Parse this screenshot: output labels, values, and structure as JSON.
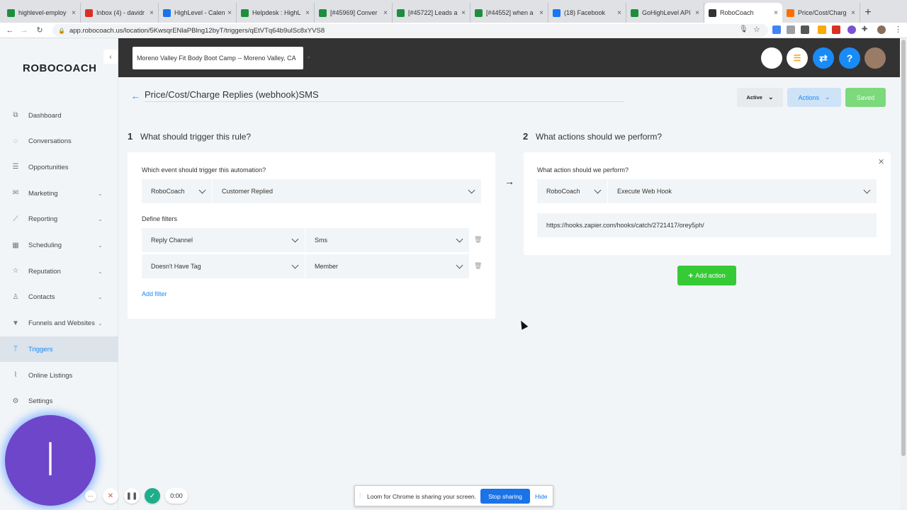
{
  "browser": {
    "tabs": [
      {
        "label": "highlevel-employ",
        "color": "#1e8e3e"
      },
      {
        "label": "Inbox (4) - davidr",
        "color": "#d93025"
      },
      {
        "label": "HighLevel - Calen",
        "color": "#1a73e8"
      },
      {
        "label": "Helpdesk : HighL",
        "color": "#1e8e3e"
      },
      {
        "label": "[#45969] Conver",
        "color": "#1e8e3e"
      },
      {
        "label": "[#45722] Leads a",
        "color": "#1e8e3e"
      },
      {
        "label": "[#44552] when a",
        "color": "#1e8e3e"
      },
      {
        "label": "(18) Facebook",
        "color": "#1877f2"
      },
      {
        "label": "GoHighLevel API",
        "color": "#1e8e3e"
      },
      {
        "label": "RoboCoach",
        "color": "#333333",
        "active": true
      },
      {
        "label": "Price/Cost/Charg",
        "color": "#ff6d00"
      }
    ],
    "url": "app.robocoach.us/location/5KwsqrENlaPBlng12byT/triggers/qEtVTq64b9ulSc8xYVS8"
  },
  "sidebar": {
    "logo": "ROBOCOACH",
    "items": [
      {
        "label": "Dashboard",
        "icon": "dashboard-icon",
        "glyph": "⧉"
      },
      {
        "label": "Conversations",
        "icon": "chat-icon",
        "glyph": "◌"
      },
      {
        "label": "Opportunities",
        "icon": "layers-icon",
        "glyph": "☰"
      },
      {
        "label": "Marketing",
        "icon": "mail-icon",
        "glyph": "✉",
        "chev": true
      },
      {
        "label": "Reporting",
        "icon": "chart-icon",
        "glyph": "⟋",
        "chev": true
      },
      {
        "label": "Scheduling",
        "icon": "calendar-icon",
        "glyph": "▦",
        "chev": true
      },
      {
        "label": "Reputation",
        "icon": "star-icon",
        "glyph": "☆",
        "chev": true
      },
      {
        "label": "Contacts",
        "icon": "person-icon",
        "glyph": "♙",
        "chev": true
      },
      {
        "label": "Funnels and Websites",
        "icon": "filter-icon",
        "glyph": "▼",
        "chev": true
      },
      {
        "label": "Triggers",
        "icon": "branch-icon",
        "glyph": "ᛘ",
        "active": true
      },
      {
        "label": "Online Listings",
        "icon": "pulse-icon",
        "glyph": "⌇"
      },
      {
        "label": "Settings",
        "icon": "gear-icon",
        "glyph": "⚙"
      }
    ]
  },
  "header": {
    "location": "Moreno Valley Fit Body Boot Camp -- Moreno Valley, CA"
  },
  "page": {
    "title": "Price/Cost/Charge Replies (webhook)SMS",
    "status": "Active",
    "actions_label": "Actions",
    "saved_label": "Saved"
  },
  "trigger": {
    "step": "1",
    "title": "What should trigger this rule?",
    "event_label": "Which event should trigger this automation?",
    "app": "RoboCoach",
    "event": "Customer Replied",
    "filters_label": "Define filters",
    "filters": [
      {
        "field": "Reply Channel",
        "value": "Sms"
      },
      {
        "field": "Doesn't Have Tag",
        "value": "Member"
      }
    ],
    "add_filter": "Add filter"
  },
  "actions": {
    "step": "2",
    "title": "What actions should we perform?",
    "action_label": "What action should we perform?",
    "app": "RoboCoach",
    "action": "Execute Web Hook",
    "webhook_url": "https://hooks.zapier.com/hooks/catch/2721417/orey5ph/",
    "add_action": "Add action"
  },
  "loom": {
    "avatar_letter": "I",
    "timer": "0:00",
    "banner": "Loom for Chrome is sharing your screen.",
    "stop": "Stop sharing",
    "hide": "Hide"
  }
}
